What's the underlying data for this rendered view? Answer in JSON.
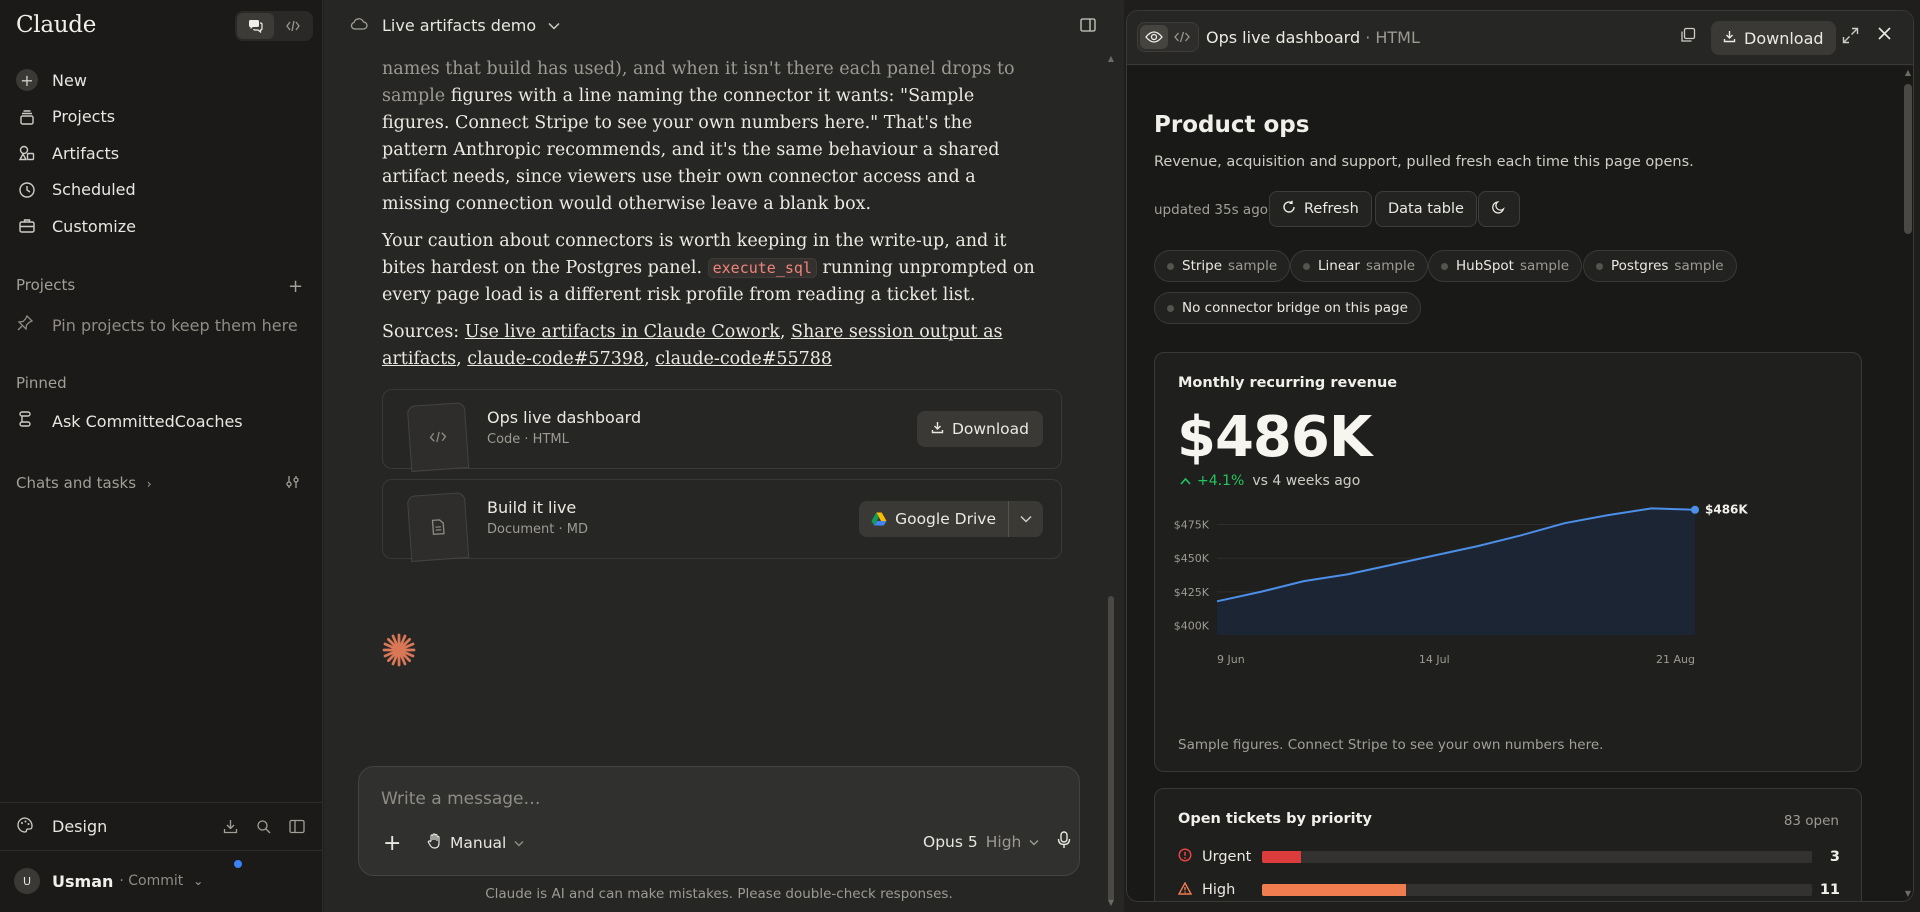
{
  "sidebar": {
    "brand": "Claude",
    "nav": [
      {
        "label": "New",
        "icon": "plus-icon"
      },
      {
        "label": "Projects",
        "icon": "stack-icon"
      },
      {
        "label": "Artifacts",
        "icon": "shapes-icon"
      },
      {
        "label": "Scheduled",
        "icon": "clock-icon"
      },
      {
        "label": "Customize",
        "icon": "briefcase-icon"
      }
    ],
    "projects_label": "Projects",
    "pin_hint": "Pin projects to keep them here",
    "pinned_label": "Pinned",
    "pinned_item": "Ask CommittedCoaches",
    "chats_label": "Chats and tasks",
    "design_label": "Design",
    "user": {
      "initial": "U",
      "name": "Usman",
      "org": "· Commit"
    }
  },
  "chat": {
    "title": "Live artifacts demo",
    "paragraphs": {
      "p1_fade": "names that build has used), and when it isn't there each panel drops to sample",
      "p1": "figures with a line naming the connector it wants: \"Sample figures. Connect Stripe to see your own numbers here.\" That's the pattern Anthropic recommends, and it's the same behaviour a shared artifact needs, since viewers use their own connector access and a missing connection would otherwise leave a blank box.",
      "p2_a": "Your caution about connectors is worth keeping in the write-up, and it bites hardest on the Postgres panel.",
      "p2_code": "execute_sql",
      "p2_b": "running unprompted on every page load is a different risk profile from reading a ticket list.",
      "sources_label": "Sources:",
      "sources": [
        "Use live artifacts in Claude Cowork",
        "Share session output as artifacts",
        "claude-code#57398",
        "claude-code#55788"
      ]
    },
    "files": [
      {
        "name": "Ops live dashboard",
        "meta": "Code · HTML",
        "action": "Download"
      },
      {
        "name": "Build it live",
        "meta": "Document · MD",
        "action": "Google Drive"
      }
    ],
    "composer": {
      "placeholder": "Write a message…",
      "mode": "Manual",
      "model": "Opus 5",
      "effort": "High"
    },
    "disclaimer": "Claude is AI and can make mistakes. Please double-check responses."
  },
  "artifact": {
    "title": "Ops live dashboard",
    "kind": "· HTML",
    "download_label": "Download",
    "dashboard": {
      "title": "Product ops",
      "subtitle": "Revenue, acquisition and support, pulled fresh each time this page opens.",
      "updated": "updated 35s ago",
      "refresh_label": "Refresh",
      "table_label": "Data table",
      "chips": [
        {
          "name": "Stripe",
          "state": "sample"
        },
        {
          "name": "Linear",
          "state": "sample"
        },
        {
          "name": "HubSpot",
          "state": "sample"
        },
        {
          "name": "Postgres",
          "state": "sample"
        },
        {
          "name": "No connector bridge on this page",
          "state": ""
        }
      ],
      "mrr": {
        "title": "Monthly recurring revenue",
        "value": "$486K",
        "delta": "+4.1%",
        "delta_context": "vs 4 weeks ago",
        "note": "Sample figures. Connect Stripe to see your own numbers here."
      },
      "tickets": {
        "title": "Open tickets by priority",
        "count_label": "83 open",
        "rows": [
          {
            "label": "Urgent",
            "count": "3",
            "value": 3,
            "color": "#dc3c3c",
            "icon": "alert-circle-icon"
          },
          {
            "label": "High",
            "count": "11",
            "value": 11,
            "color": "#ef7d50",
            "icon": "warning-triangle-icon"
          }
        ],
        "scale_max": 42
      }
    }
  },
  "chart_data": {
    "type": "area",
    "title": "Monthly recurring revenue",
    "x": [
      "9 Jun",
      "16 Jun",
      "23 Jun",
      "30 Jun",
      "7 Jul",
      "14 Jul",
      "21 Jul",
      "28 Jul",
      "4 Aug",
      "11 Aug",
      "18 Aug",
      "21 Aug"
    ],
    "series": [
      {
        "values": [
          418,
          425,
          433,
          438,
          445,
          452,
          459,
          467,
          476,
          482,
          487,
          486
        ]
      }
    ],
    "x_tick_labels": [
      "9 Jun",
      "14 Jul",
      "21 Aug"
    ],
    "y_tick_labels": [
      "$400K",
      "$425K",
      "$450K",
      "$475K"
    ],
    "y_ticks": [
      400,
      425,
      450,
      475
    ],
    "ylim": [
      393,
      491
    ],
    "end_label": "$486K",
    "grid": true,
    "colors": {
      "line": "#4c8fe8",
      "fill": "#1c2533"
    }
  }
}
